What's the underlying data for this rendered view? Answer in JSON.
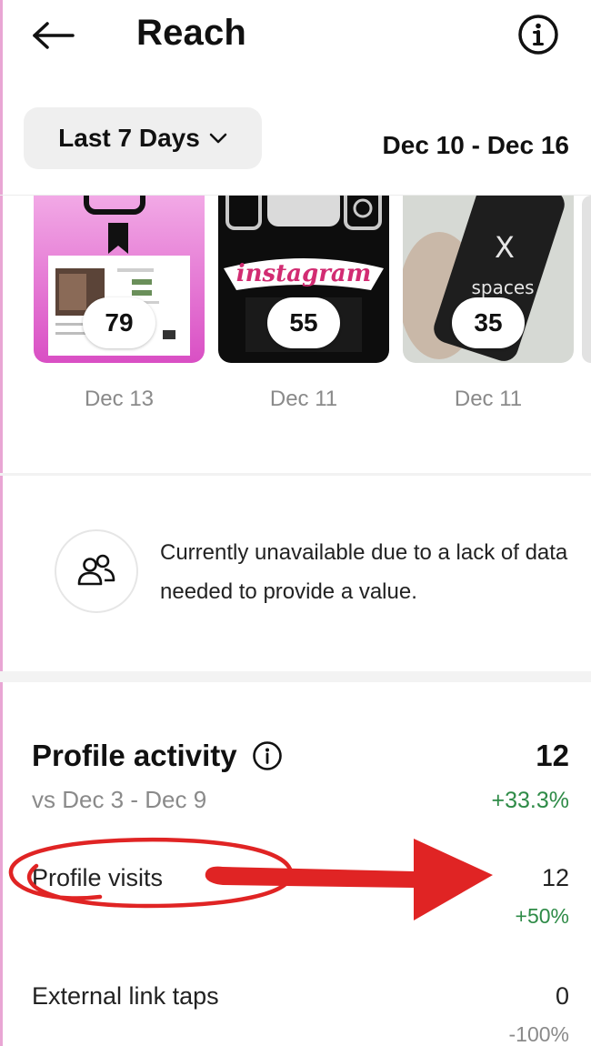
{
  "header": {
    "title": "Reach",
    "back_icon": "arrow-left-icon",
    "info_icon": "info-circle-icon"
  },
  "filter": {
    "range_label": "Last 7 Days",
    "dropdown_icon": "chevron-down-icon",
    "date_range": "Dec 10 - Dec 16"
  },
  "top_content": [
    {
      "count": "79",
      "date": "Dec 13",
      "thumbnail_text": ""
    },
    {
      "count": "55",
      "date": "Dec 11",
      "thumbnail_text": "instagram"
    },
    {
      "count": "35",
      "date": "Dec 11",
      "thumbnail_text": "spaces"
    }
  ],
  "notice": {
    "icon": "people-icon",
    "text": "Currently unavailable due to a lack of data needed to provide a value."
  },
  "profile_activity": {
    "title": "Profile activity",
    "info_icon": "info-circle-icon",
    "total": "12",
    "comparison": "vs Dec 3 - Dec 9",
    "change": "+33.3%",
    "metrics": [
      {
        "label": "Profile visits",
        "value": "12",
        "change": "+50%"
      },
      {
        "label": "External link taps",
        "value": "0",
        "change": "-100%"
      }
    ]
  },
  "colors": {
    "positive": "#2e8b47",
    "negative": "#8a8a8a",
    "annotation": "#e02424",
    "range_button_bg": "#efefef"
  }
}
